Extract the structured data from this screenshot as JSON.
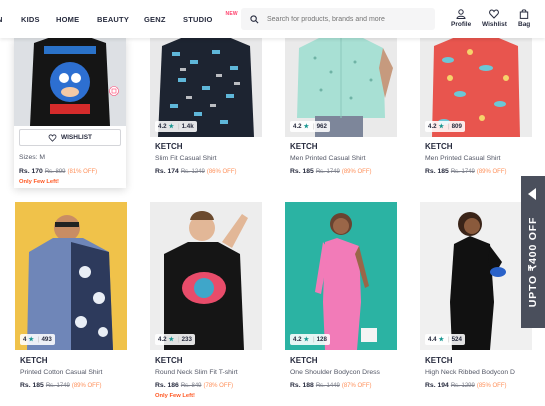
{
  "nav": {
    "items": [
      "N",
      "KIDS",
      "HOME",
      "BEAUTY",
      "GENZ",
      "STUDIO"
    ],
    "studio_tag": "NEW"
  },
  "search": {
    "placeholder": "Search for products, brands and more"
  },
  "header_icons": {
    "profile": "Profile",
    "wishlist": "Wishlist",
    "bag": "Bag"
  },
  "products": [
    {
      "brand": "",
      "title": "",
      "price": "Rs. 170",
      "mrp": "Rs. 899",
      "discount": "(81% OFF)",
      "rating": "",
      "rating_count": "",
      "sizes": "Sizes: M",
      "wishlist_label": "WISHLIST",
      "few_left": "Only Few Left!",
      "image_bg": "#dde0e4",
      "shirt_color": "#111111"
    },
    {
      "brand": "KETCH",
      "title": "Slim Fit Casual Shirt",
      "price": "Rs. 174",
      "mrp": "Rs. 1249",
      "discount": "(86% OFF)",
      "rating": "4.2",
      "rating_count": "1.4k",
      "image_bg": "#e9e9ea",
      "shirt_color": "#1d2431"
    },
    {
      "brand": "KETCH",
      "title": "Men Printed Casual Shirt",
      "price": "Rs. 185",
      "mrp": "Rs. 1749",
      "discount": "(89% OFF)",
      "rating": "4.2",
      "rating_count": "962",
      "image_bg": "#eaeaea",
      "shirt_color": "#a8e0d4"
    },
    {
      "brand": "KETCH",
      "title": "Men Printed Casual Shirt",
      "price": "Rs. 185",
      "mrp": "Rs. 1749",
      "discount": "(89% OFF)",
      "rating": "4.2",
      "rating_count": "809",
      "image_bg": "#ececec",
      "shirt_color": "#e8554e"
    },
    {
      "brand": "KETCH",
      "title": "Printed Cotton Casual Shirt",
      "price": "Rs. 185",
      "mrp": "Rs. 1749",
      "discount": "(89% OFF)",
      "rating": "4",
      "rating_count": "493",
      "image_bg": "#f0c24a",
      "shirt_color": "#6f86b8"
    },
    {
      "brand": "KETCH",
      "title": "Round Neck Slim Fit T-shirt",
      "price": "Rs. 186",
      "mrp": "Rs. 849",
      "discount": "(78% OFF)",
      "rating": "4.2",
      "rating_count": "233",
      "few_left": "Only Few Left!",
      "image_bg": "#ededed",
      "shirt_color": "#151515"
    },
    {
      "brand": "KETCH",
      "title": "One Shoulder Bodycon Dress",
      "price": "Rs. 188",
      "mrp": "Rs. 1449",
      "discount": "(87% OFF)",
      "rating": "4.2",
      "rating_count": "128",
      "image_bg": "#2bb3a3",
      "shirt_color": "#f27bb8"
    },
    {
      "brand": "KETCH",
      "title": "High Neck Ribbed Bodycon D",
      "price": "Rs. 194",
      "mrp": "Rs. 1299",
      "discount": "(85% OFF)",
      "rating": "4.4",
      "rating_count": "524",
      "image_bg": "#f0f0f0",
      "shirt_color": "#111111"
    }
  ],
  "promo": {
    "text": "UPTO ₹400 OFF"
  },
  "colors": {
    "accent": "#ff3f6c",
    "discount": "#ff905a",
    "star": "#14958f",
    "promo_bg": "#4a4f5c"
  }
}
